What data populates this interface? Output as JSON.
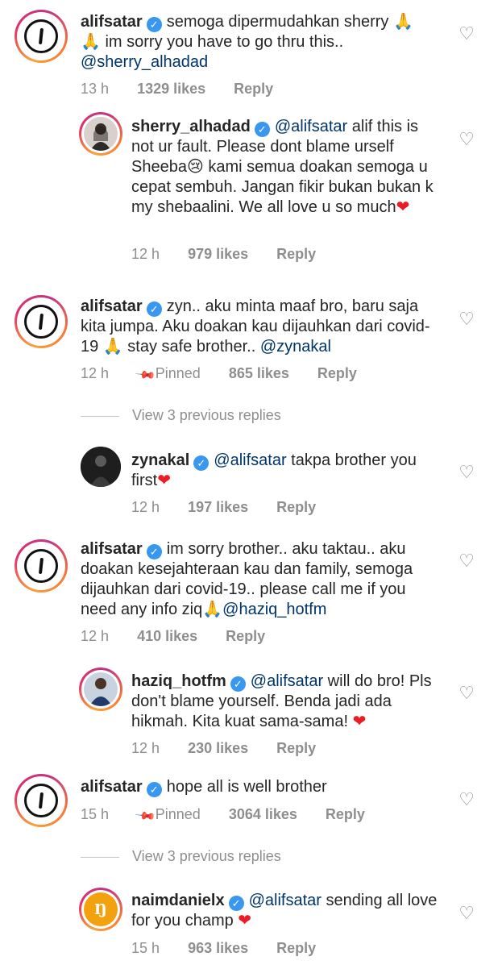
{
  "icons": {
    "like": "heart-outline-icon",
    "verified": "verified-badge-icon",
    "pin": "pin-icon"
  },
  "colors": {
    "verified": "#3897f0",
    "mention": "#003569",
    "meta": "#8e8e8e"
  },
  "comments": [
    {
      "username": "alifsatar",
      "segments": [
        {
          "t": "semoga dipermudahkan sherry "
        },
        {
          "t": "🙏🙏",
          "cls": "pray"
        },
        {
          "t": " im sorry you have to go thru this.. "
        },
        {
          "t": "@sherry_alhadad",
          "cls": "mention"
        }
      ],
      "time": "13 h",
      "likes": "1329 likes",
      "reply": "Reply"
    },
    {
      "username": "sherry_alhadad",
      "segments": [
        {
          "t": "@alifsatar",
          "cls": "mention"
        },
        {
          "t": " alif this is not ur fault. Please dont blame urself Sheeba😢 kami semua doakan semoga u cepat sembuh. Jangan fikir bukan bukan k my shebaalini. We all love u so much"
        },
        {
          "t": "❤",
          "cls": "heart"
        }
      ],
      "time": "12 h",
      "likes": "979 likes",
      "reply": "Reply"
    },
    {
      "username": "alifsatar",
      "segments": [
        {
          "t": "zyn.. aku minta maaf bro, baru saja kita jumpa. Aku doakan kau dijauhkan dari covid-19 "
        },
        {
          "t": "🙏",
          "cls": "pray"
        },
        {
          "t": " stay safe brother.. "
        },
        {
          "t": "@zynakal",
          "cls": "mention"
        }
      ],
      "time": "12 h",
      "pinned": "Pinned",
      "likes": "865 likes",
      "reply": "Reply"
    },
    {
      "username": "zynakal",
      "segments": [
        {
          "t": "@alifsatar",
          "cls": "mention"
        },
        {
          "t": " takpa brother you first"
        },
        {
          "t": "❤",
          "cls": "heart"
        }
      ],
      "time": "12 h",
      "likes": "197 likes",
      "reply": "Reply"
    },
    {
      "username": "alifsatar",
      "segments": [
        {
          "t": "im sorry brother.. aku taktau.. aku doakan kesejahteraan kau dan family, semoga dijauhkan dari covid-19.. please call me if you need any info ziq"
        },
        {
          "t": "🙏",
          "cls": "pray"
        },
        {
          "t": "@haziq_hotfm",
          "cls": "mention"
        }
      ],
      "time": "12 h",
      "likes": "410 likes",
      "reply": "Reply"
    },
    {
      "username": "haziq_hotfm",
      "segments": [
        {
          "t": "@alifsatar",
          "cls": "mention"
        },
        {
          "t": " will do bro! Pls don't blame yourself. Benda jadi ada hikmah. Kita kuat sama-sama! "
        },
        {
          "t": "❤",
          "cls": "heart"
        }
      ],
      "time": "12 h",
      "likes": "230 likes",
      "reply": "Reply"
    },
    {
      "username": "alifsatar",
      "segments": [
        {
          "t": "hope all is well brother"
        }
      ],
      "time": "15 h",
      "pinned": "Pinned",
      "likes": "3064 likes",
      "reply": "Reply"
    },
    {
      "username": "naimdanielx",
      "segments": [
        {
          "t": "@alifsatar",
          "cls": "mention"
        },
        {
          "t": " sending all love for you champ "
        },
        {
          "t": "❤",
          "cls": "heart"
        }
      ],
      "time": "15 h",
      "likes": "963 likes",
      "reply": "Reply"
    }
  ],
  "view_replies": [
    {
      "label": "View 3 previous replies"
    },
    {
      "label": "View 3 previous replies"
    }
  ]
}
